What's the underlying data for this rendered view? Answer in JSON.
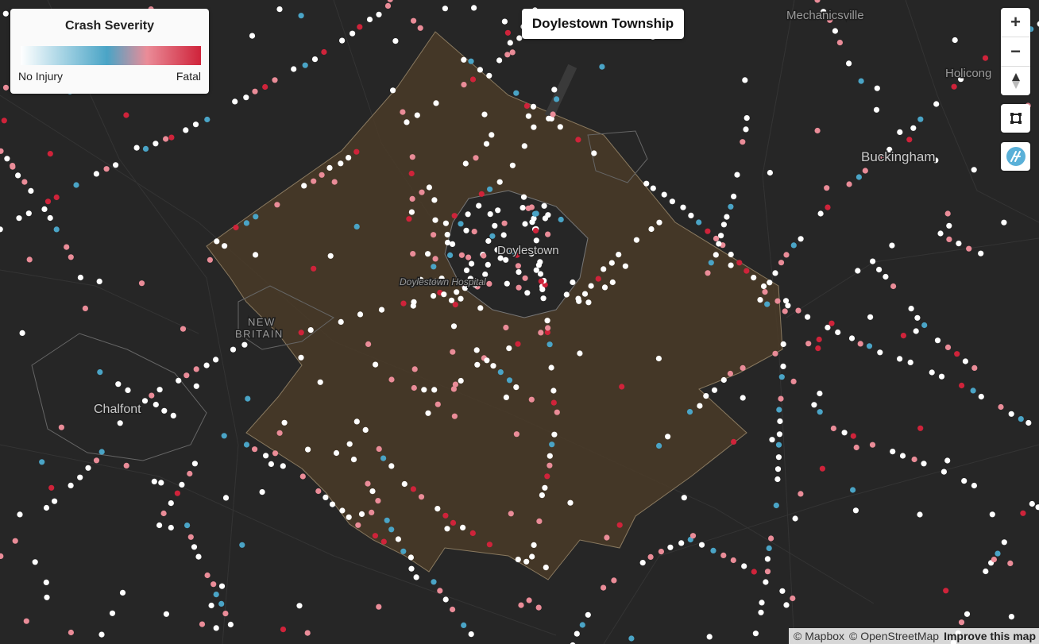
{
  "legend": {
    "title": "Crash Severity",
    "min_label": "No Injury",
    "max_label": "Fatal",
    "gradient": [
      "#ffffff",
      "#9fd0e2",
      "#4aa4c6",
      "#ea8c98",
      "#cf233a"
    ]
  },
  "map_title": "Doylestown Township",
  "places": {
    "mechanicsville": "Mechanicsville",
    "holicong": "Holicong",
    "buckingham": "Buckingham",
    "doylestown": "Doylestown",
    "hospital": "Doylestown Hospital",
    "new": "NEW",
    "britain": "BRITAIN",
    "chalfont": "Chalfont"
  },
  "controls": {
    "zoom_in": "+",
    "zoom_out": "−",
    "compass": "compass-icon",
    "draw_polygon": "polygon-icon",
    "reset": "reset-icon"
  },
  "attribution": {
    "mapbox": "© Mapbox",
    "osm": "© OpenStreetMap",
    "improve": "Improve this map"
  },
  "colors": {
    "background": "#262626",
    "township_fill": "#4a3b28",
    "no_injury": "#ffffff",
    "minor": "#4aa4c6",
    "serious": "#ea8c98",
    "fatal": "#cf233a"
  }
}
